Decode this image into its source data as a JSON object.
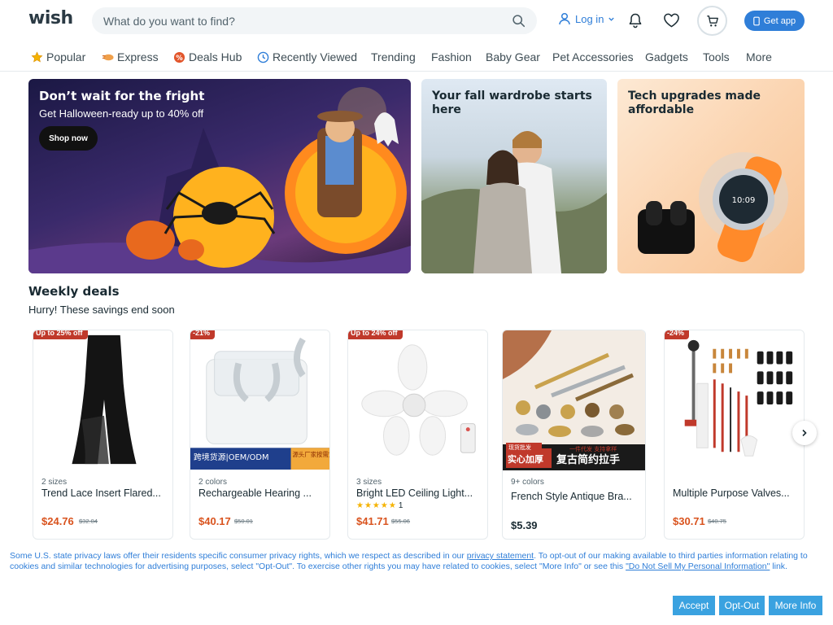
{
  "header": {
    "logo": "wish",
    "search_placeholder": "What do you want to find?",
    "login_label": "Log in",
    "get_app_label": "Get app"
  },
  "nav": [
    {
      "label": "Popular",
      "icon": "star-icon"
    },
    {
      "label": "Express",
      "icon": "express-icon"
    },
    {
      "label": "Deals Hub",
      "icon": "deals-icon"
    },
    {
      "label": "Recently Viewed",
      "icon": "clock-icon"
    },
    {
      "label": "Trending"
    },
    {
      "label": "Fashion"
    },
    {
      "label": "Baby Gear"
    },
    {
      "label": "Pet Accessories"
    },
    {
      "label": "Gadgets"
    },
    {
      "label": "Tools"
    },
    {
      "label": "More"
    }
  ],
  "banners": [
    {
      "title": "Don’t wait for the fright",
      "subtitle": "Get Halloween-ready up to 40% off",
      "button": "Shop now"
    },
    {
      "title": "Your fall wardrobe starts here"
    },
    {
      "title": "Tech upgrades made affordable"
    }
  ],
  "weekly_deals": {
    "title": "Weekly deals",
    "subtitle": "Hurry! These savings end soon",
    "products": [
      {
        "badge": "Up to 25% off",
        "variant": "2 sizes",
        "name": "Trend Lace Insert Flared...",
        "price": "$24.76",
        "old_price": "$32.04"
      },
      {
        "badge": "-21%",
        "variant": "2 colors",
        "name": "Rechargeable Hearing ...",
        "price": "$40.17",
        "old_price": "$50.01",
        "banner_text_left": "跨境货源|OEM/ODM",
        "banner_text_right": "源头厂家按需定制"
      },
      {
        "badge": "Up to 24% off",
        "variant": "3 sizes",
        "name": "Bright LED Ceiling Light...",
        "stars": "★★★★★",
        "rating_count": "1",
        "price": "$41.71",
        "old_price": "$55.06"
      },
      {
        "badge": "",
        "variant": "9+ colors",
        "name": "French Style Antique Bra...",
        "price": "$5.39",
        "old_price": "",
        "banner_text_left": "实心加厚",
        "banner_text_right": "复古简约拉手",
        "tag_top_left": "现货批发",
        "tag_top_right": "一件代发 支持拿样"
      },
      {
        "badge": "-24%",
        "variant": "",
        "name": "Multiple Purpose Valves...",
        "price": "$30.71",
        "old_price": "$40.75"
      }
    ]
  },
  "privacy": {
    "text_1": "Some U.S. state privacy laws offer their residents specific consumer privacy rights, which we respect as described in our ",
    "link_1": "privacy statement",
    "text_2": ". To opt-out of our making available to third parties information relating to cookies and similar technologies for advertising purposes, select \"Opt-Out\". To exercise other rights you may have related to cookies, select \"More Info\" or see this ",
    "link_2": "\"Do Not Sell My Personal Information\"",
    "text_3": " link.",
    "accept": "Accept",
    "opt_out": "Opt-Out",
    "more_info": "More Info"
  },
  "colors": {
    "brand_blue": "#2f7ed8",
    "price_orange": "#d9531e",
    "badge_red": "#c0392b",
    "privacy_button": "#3aa2e0"
  }
}
